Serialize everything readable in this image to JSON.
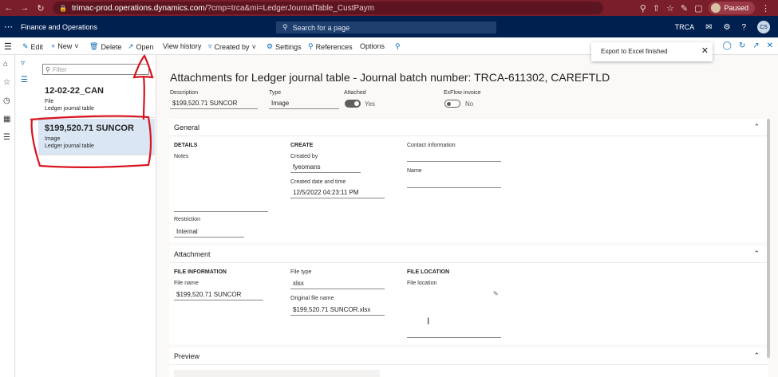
{
  "browser": {
    "url_host": "trimac-prod.operations.dynamics.com",
    "url_path": "/?cmp=trca&mi=LedgerJournalTable_CustPaym",
    "paused_label": "Paused"
  },
  "app_header": {
    "title": "Finance and Operations",
    "search_placeholder": "Search for a page",
    "company": "TRCA",
    "avatar_initials": "CS"
  },
  "action_pane": {
    "edit": "Edit",
    "new": "New",
    "delete": "Delete",
    "open": "Open",
    "view_history": "View history",
    "created_by": "Created by",
    "settings": "Settings",
    "references": "References",
    "options": "Options"
  },
  "toast": {
    "message": "Export to Excel finished"
  },
  "list": {
    "filter_placeholder": "Filter",
    "items": [
      {
        "title": "12-02-22_CAN",
        "type": "File",
        "source": "Ledger journal table"
      },
      {
        "title": "$199,520.71 SUNCOR",
        "type": "Image",
        "source": "Ledger journal table"
      }
    ]
  },
  "main": {
    "title": "Attachments for Ledger journal table - Journal batch number: TRCA-611302, CAREFTLD",
    "description_label": "Description",
    "description_value": "$199,520.71 SUNCOR",
    "type_label": "Type",
    "type_value": "Image",
    "attached_label": "Attached",
    "attached_value": "Yes",
    "exflow_label": "ExFlow invoice",
    "exflow_value": "No"
  },
  "general": {
    "title": "General",
    "details_head": "DETAILS",
    "notes_label": "Notes",
    "restriction_label": "Restriction",
    "restriction_value": "Internal",
    "create_head": "CREATE",
    "created_by_label": "Created by",
    "created_by_value": "fyeomans",
    "created_dt_label": "Created date and time",
    "created_dt_value": "12/5/2022 04:23:11 PM",
    "contact_label": "Contact information",
    "name_label": "Name"
  },
  "attachment": {
    "title": "Attachment",
    "file_info_head": "FILE INFORMATION",
    "file_name_label": "File name",
    "file_name_value": "$199,520.71 SUNCOR",
    "file_type_label": "File type",
    "file_type_value": "xlsx",
    "orig_name_label": "Original file name",
    "orig_name_value": "$199,520.71 SUNCOR.xlsx",
    "location_head": "FILE LOCATION",
    "location_label": "File location"
  },
  "preview": {
    "title": "Preview"
  },
  "colors": {
    "header_navy": "#002050",
    "browser_maroon": "#7a1e2c",
    "accent_blue": "#0f6cbd",
    "annotation_red": "#d9141f",
    "selected_row": "#dbe6f4"
  }
}
